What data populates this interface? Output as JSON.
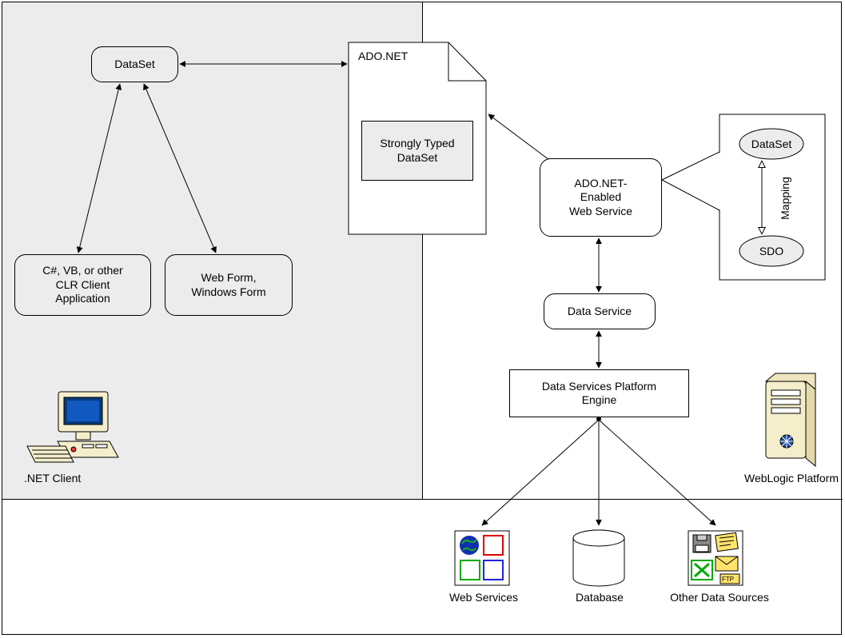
{
  "nodes": {
    "dataset_client": "DataSet",
    "clr_app": "C#, VB, or other\nCLR Client\nApplication",
    "webform": "Web Form,\nWindows Form",
    "adonet_doc": "ADO.NET",
    "strongly_typed": "Strongly Typed\nDataSet",
    "web_service": "ADO.NET-\nEnabled\nWeb Service",
    "data_service": "Data Service",
    "dsp_engine": "Data Services Platform\nEngine",
    "dataset_right": "DataSet",
    "sdo": "SDO",
    "mapping": "Mapping"
  },
  "labels": {
    "net_client": ".NET Client",
    "weblogic": "WebLogic Platform",
    "web_services": "Web Services",
    "database": "Database",
    "other_ds": "Other Data Sources"
  }
}
